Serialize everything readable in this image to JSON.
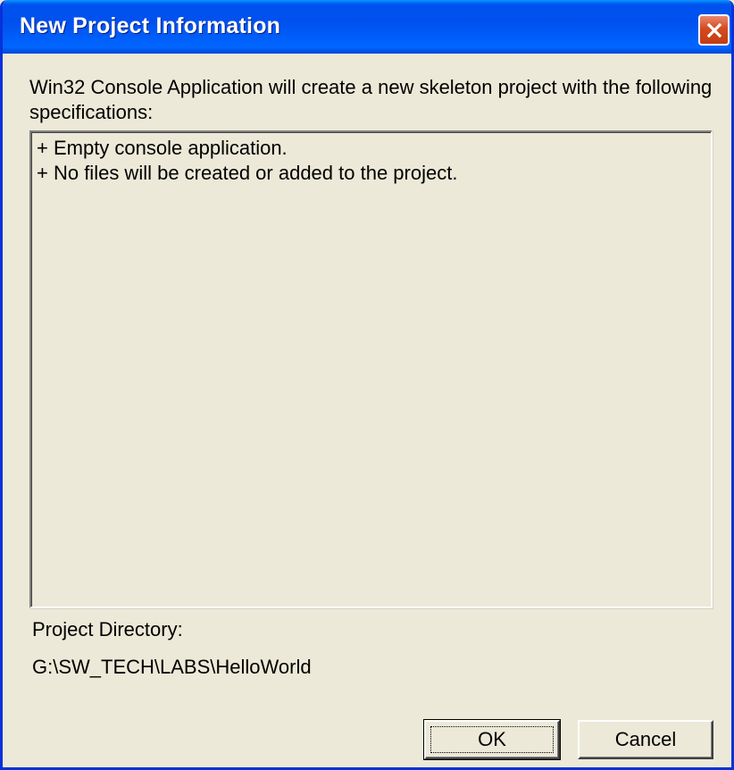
{
  "window": {
    "title": "New Project Information"
  },
  "intro_text": "Win32 Console Application will create a new skeleton project with the following specifications:",
  "specifications": [
    "+ Empty console application.",
    "+ No files will be created or added to the project."
  ],
  "project_directory": {
    "label": "Project Directory:",
    "path": "G:\\SW_TECH\\LABS\\HelloWorld"
  },
  "buttons": {
    "ok_label": "OK",
    "cancel_label": "Cancel"
  },
  "icons": {
    "close": "close-icon"
  },
  "colors": {
    "titlebar": "#0054e3",
    "close_button": "#d64a1f",
    "dialog_background": "#ece9d8"
  }
}
